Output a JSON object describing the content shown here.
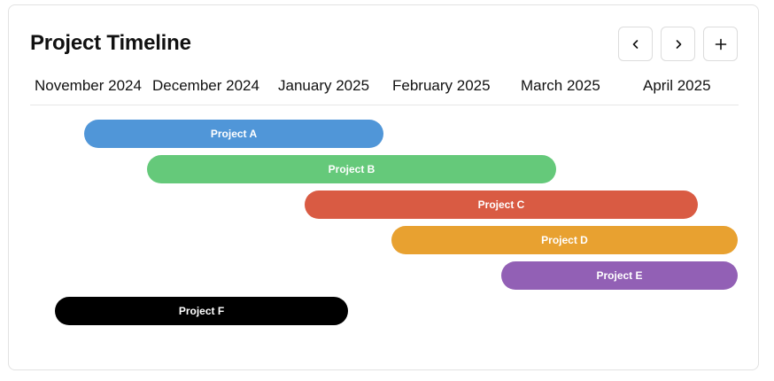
{
  "header": {
    "title": "Project Timeline",
    "prev_icon": "chevron-left-icon",
    "next_icon": "chevron-right-icon",
    "add_icon": "plus-icon"
  },
  "timeline": {
    "months": [
      "November 2024",
      "December 2024",
      "January 2025",
      "February 2025",
      "March 2025",
      "April 2025"
    ],
    "projects": [
      {
        "name": "Project A",
        "color": "#5096d8"
      },
      {
        "name": "Project B",
        "color": "#65c97a"
      },
      {
        "name": "Project C",
        "color": "#d95b43"
      },
      {
        "name": "Project D",
        "color": "#e8a130"
      },
      {
        "name": "Project E",
        "color": "#9260b5"
      },
      {
        "name": "Project F",
        "color": "#000000"
      }
    ]
  }
}
